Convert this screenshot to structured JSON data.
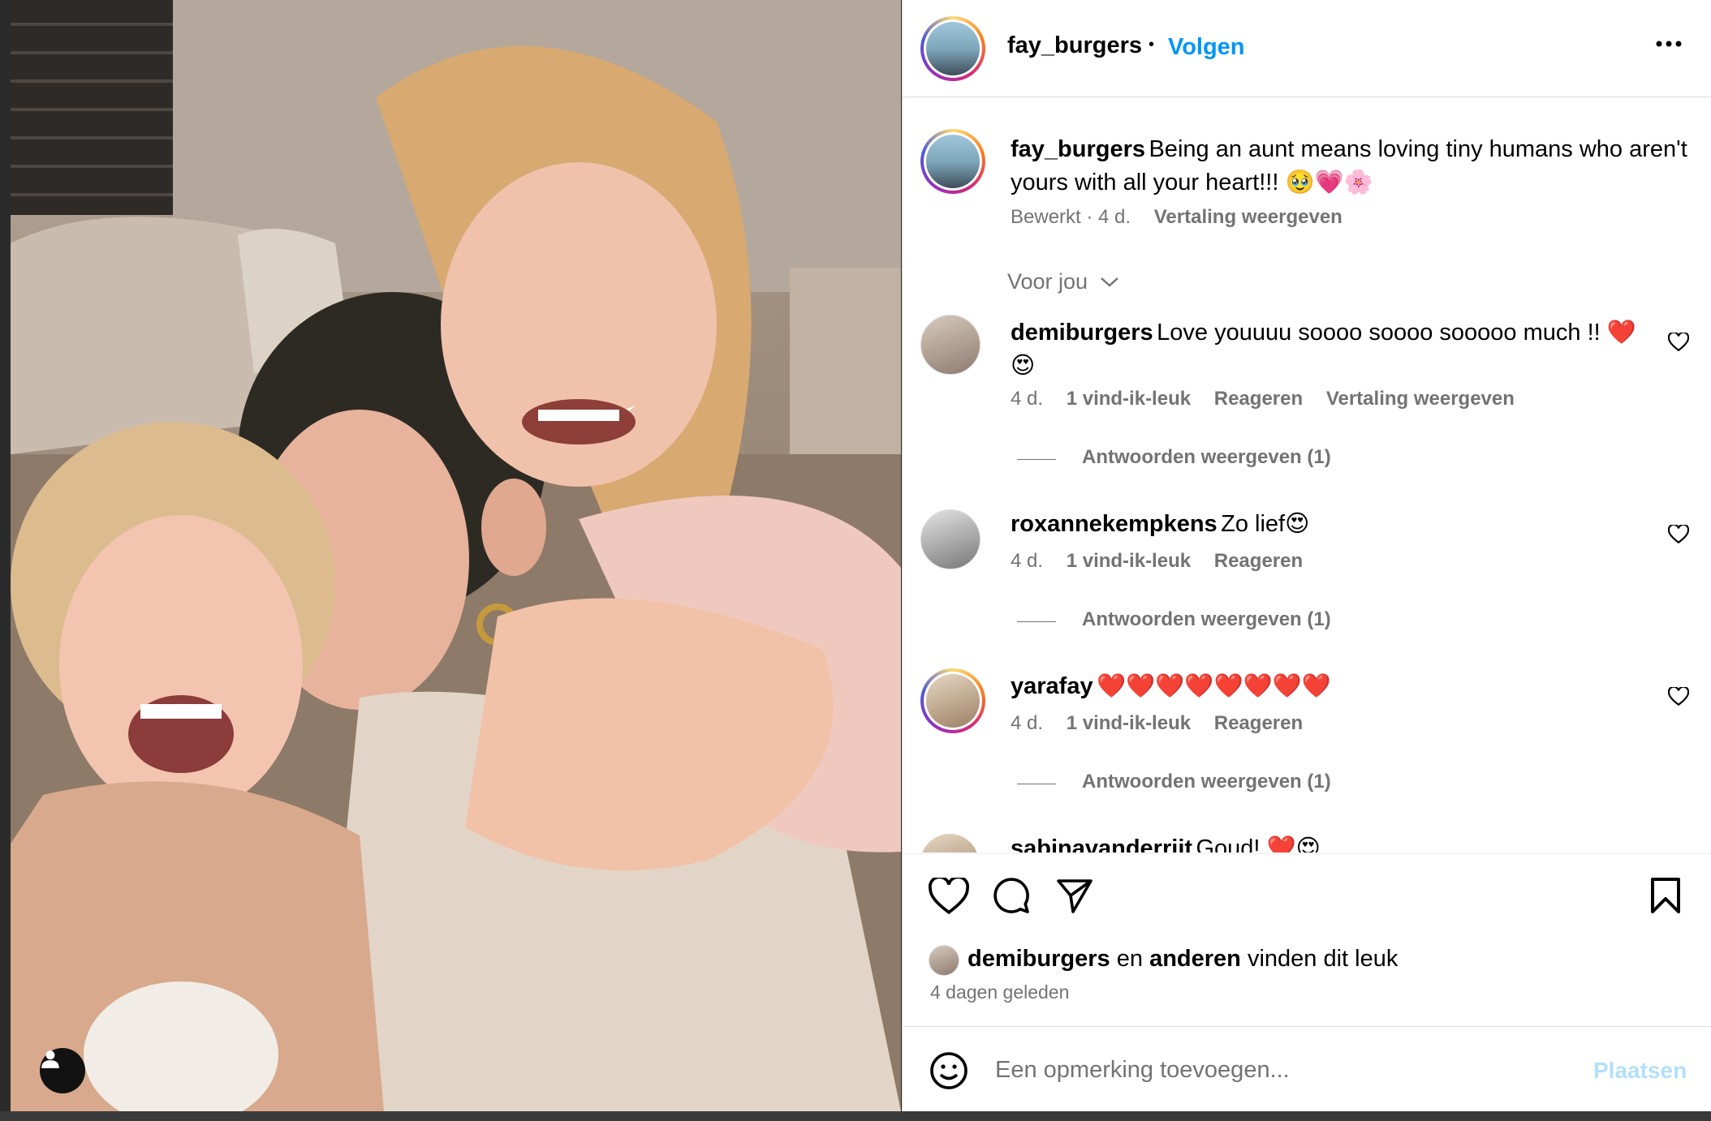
{
  "post": {
    "username": "fay_burgers",
    "follow_label": "Volgen",
    "separator": "•",
    "caption_username": "fay_burgers",
    "caption_text": "Being an aunt means loving tiny humans who aren't yours with all your heart!!! 🥹💗🌸",
    "caption_line1": "Being an aunt means loving tiny humans who aren't",
    "caption_line2": "yours with all your heart!!! 🥹💗🌸",
    "caption_edited": "Bewerkt · 4 d.",
    "caption_translate": "Vertaling weergeven",
    "filter_label": "Voor jou"
  },
  "comments": [
    {
      "username": "demiburgers",
      "text_line1": "Love youuuu soooo soooo sooooo much !! ❤️",
      "text_line2": "😍",
      "time": "4 d.",
      "likes": "1 vind-ik-leuk",
      "reply": "Reageren",
      "translate": "Vertaling weergeven",
      "view_replies": "Antwoorden weergeven (1)"
    },
    {
      "username": "roxannekempkens",
      "text_line1": "Zo lief😍",
      "time": "4 d.",
      "likes": "1 vind-ik-leuk",
      "reply": "Reageren",
      "view_replies": "Antwoorden weergeven (1)"
    },
    {
      "username": "yarafay",
      "text_line1": "❤️❤️❤️❤️❤️❤️❤️❤️",
      "time": "4 d.",
      "likes": "1 vind-ik-leuk",
      "reply": "Reageren",
      "view_replies": "Antwoorden weergeven (1)"
    },
    {
      "username": "sabinavanderrijt",
      "text_line1": "Goud! ❤️😍"
    }
  ],
  "likes": {
    "user": "demiburgers",
    "connector": "en",
    "others": "anderen",
    "suffix": "vinden dit leuk"
  },
  "posted_ago": "4 dagen geleden",
  "comment_box": {
    "placeholder": "Een opmerking toevoegen...",
    "post_label": "Plaatsen"
  },
  "colors": {
    "accent": "#0095f6",
    "post_disabled": "#b2dffc",
    "meta_text": "#737373",
    "like_heart": "#ed4956"
  },
  "icons": [
    "user-tag-icon",
    "more-options-icon",
    "heart-icon",
    "comment-icon",
    "share-icon",
    "bookmark-icon",
    "emoji-icon",
    "chevron-down-icon"
  ]
}
